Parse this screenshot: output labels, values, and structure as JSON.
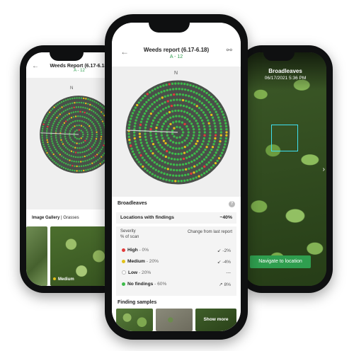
{
  "colors": {
    "accent": "#2f9e4f",
    "high": "#e23b3b",
    "medium": "#e2c21b",
    "low": "#ffffff",
    "no_findings": "#3dbb4a"
  },
  "left_phone": {
    "title": "Weeds Report (6.17-6.18)",
    "subtitle": "A - 12",
    "north": "N",
    "gallery_label": "Image Gallery",
    "gallery_sep": " | ",
    "gallery_tab": "Grasses",
    "thumb_badge": "Medium"
  },
  "center_phone": {
    "title": "Weeds report (6.17-6.18)",
    "subtitle": "A - 12",
    "north": "N",
    "section_title": "Broadleaves",
    "info_icon": "?",
    "locations_label": "Locations with findings",
    "locations_value": "~40%",
    "severity_header": "Severity",
    "severity_subheader": "% of scan",
    "change_header": "Change from last report",
    "rows": [
      {
        "label": "High",
        "value": "- 0%",
        "change": "↙ -2%"
      },
      {
        "label": "Medium",
        "value": "- 20%",
        "change": "↙ -4%"
      },
      {
        "label": "Low",
        "value": "- 20%",
        "change": "---"
      },
      {
        "label": "No findings",
        "value": "- 60%",
        "change": "↗ 8%"
      }
    ],
    "samples_title": "Finding samples",
    "show_more": "Show more"
  },
  "right_phone": {
    "title": "Broadleaves",
    "date": "06/17/2021 5:36 PM",
    "navigate_button": "Navigate to location"
  }
}
